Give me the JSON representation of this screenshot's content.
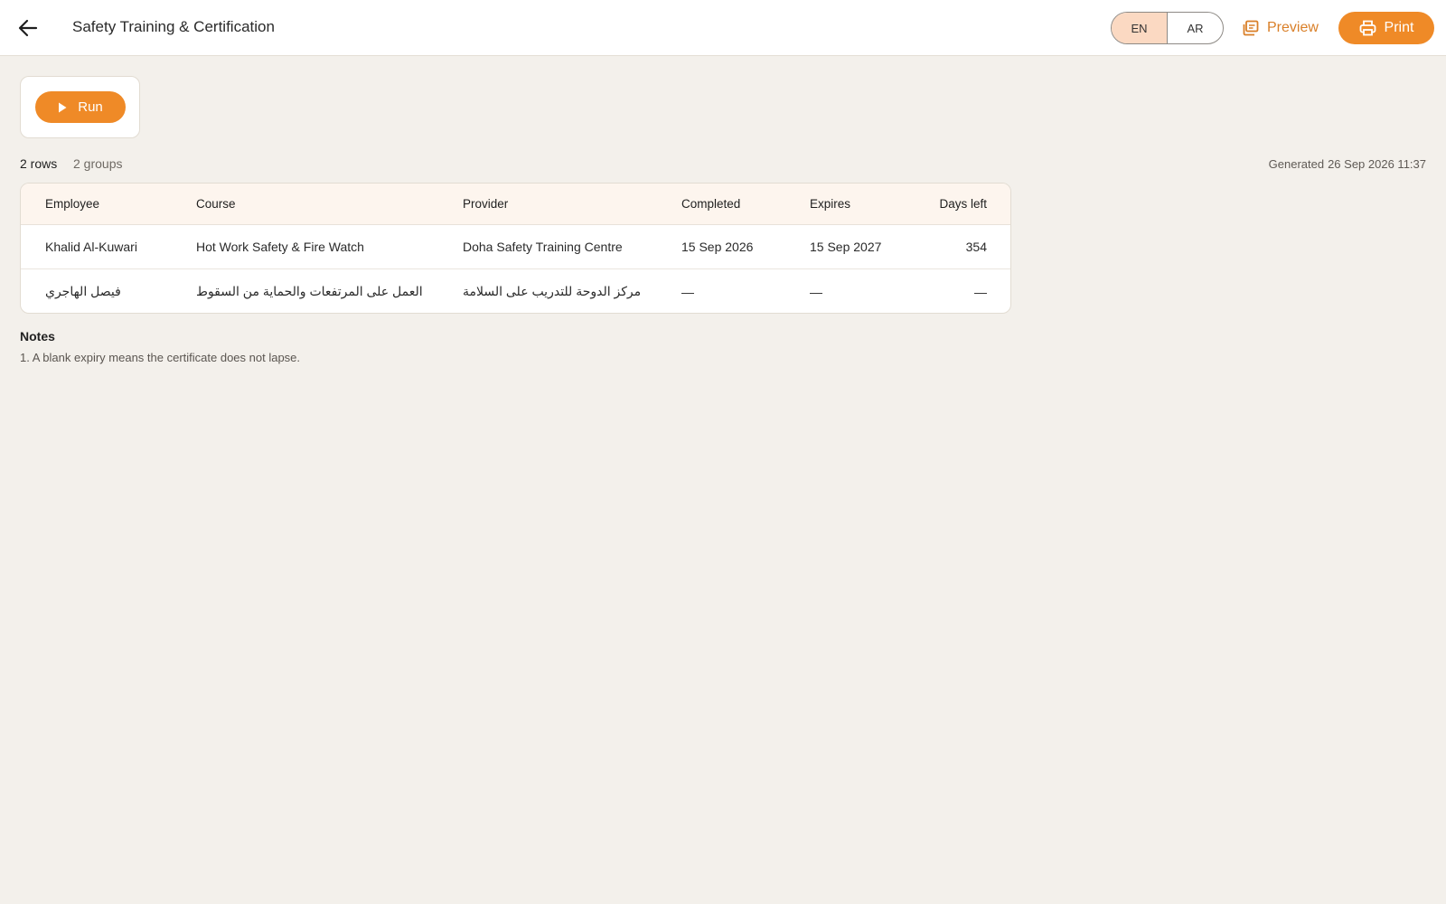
{
  "header": {
    "title": "Safety Training & Certification",
    "lang": {
      "en": "EN",
      "ar": "AR",
      "selected": "EN"
    },
    "preview_label": "Preview",
    "print_label": "Print"
  },
  "toolbar": {
    "run_label": "Run"
  },
  "summary": {
    "rows": "2 rows",
    "groups": "2 groups",
    "generated_label": "Generated",
    "generated_at": "26 Sep 2026 11:37"
  },
  "table": {
    "columns": [
      "Employee",
      "Course",
      "Provider",
      "Completed",
      "Expires",
      "Days left"
    ],
    "rows": [
      [
        "Khalid Al-Kuwari",
        "Hot Work Safety & Fire Watch",
        "Doha Safety Training Centre",
        "15 Sep 2026",
        "15 Sep 2027",
        "354"
      ],
      [
        "فيصل الهاجري",
        "العمل على المرتفعات والحماية من السقوط",
        "مركز الدوحة للتدريب على السلامة",
        "—",
        "—",
        "—"
      ]
    ]
  },
  "notes": {
    "title": "Notes",
    "items": [
      "1. A blank expiry means the certificate does not lapse."
    ]
  },
  "colors": {
    "accent": "#ef8a27",
    "accent_text": "#d97f28",
    "background": "#f3f0eb",
    "selected_lang_bg": "#fbd9c2"
  },
  "icons": {
    "back": "arrow-left-icon",
    "preview": "preview-icon",
    "print": "printer-icon",
    "run": "play-icon"
  }
}
